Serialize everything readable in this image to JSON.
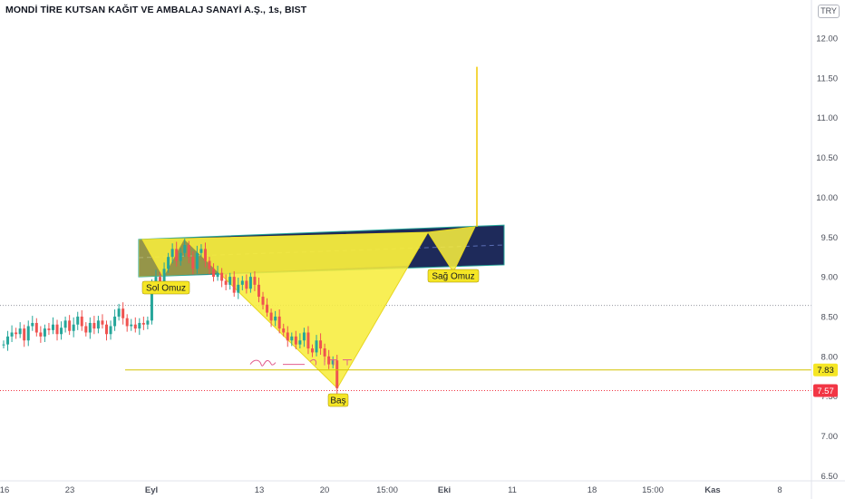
{
  "header": {
    "symbol_title": "MONDİ TİRE KUTSAN KAĞIT VE AMBALAJ SANAYİ A.Ş., 1s, BIST",
    "currency": "TRY"
  },
  "chart_data": {
    "type": "candlestick",
    "title": "MONDİ TİRE KUTSAN KAĞIT VE AMBALAJ SANAYİ A.Ş., 1s, BIST",
    "currency": "TRY",
    "y_ticks": [
      "12.00",
      "11.50",
      "11.00",
      "10.50",
      "10.00",
      "9.50",
      "9.00",
      "8.50",
      "8.00",
      "7.50",
      "7.00",
      "6.50"
    ],
    "y_tick_values": [
      12.0,
      11.5,
      11.0,
      10.5,
      10.0,
      9.5,
      9.0,
      8.5,
      8.0,
      7.5,
      7.0,
      6.5
    ],
    "ylim": [
      6.37,
      12.42
    ],
    "x_ticks": [
      "16",
      "23",
      "Eyl",
      "13",
      "20",
      "15:00",
      "Eki",
      "11",
      "18",
      "15:00",
      "Kas",
      "8"
    ],
    "x_tick_bold": [
      false,
      false,
      true,
      false,
      false,
      false,
      true,
      false,
      false,
      false,
      true,
      false
    ],
    "price_markers": [
      {
        "label": "7.83",
        "value": 7.83,
        "color": "#f5e625",
        "text_color": "#131722"
      },
      {
        "label": "7.57",
        "value": 7.57,
        "color": "#f23645",
        "text_color": "#ffffff"
      }
    ],
    "dotted_levels": [
      8.64,
      7.57
    ],
    "support_line": 7.83,
    "pattern_labels": [
      {
        "text": "Sol Omuz",
        "value": 9.0
      },
      {
        "text": "Sağ Omuz",
        "value": 9.06
      },
      {
        "text": "Baş",
        "value": 7.44
      }
    ],
    "channel": {
      "upper_start": 9.47,
      "upper_end": 9.65,
      "lower_start": 9.0,
      "lower_end": 9.15,
      "mid_start": 9.24,
      "mid_end": 9.4
    },
    "spike_line": [
      [
        9.63,
        11.64
      ]
    ],
    "series": [
      {
        "values": [
          8.15,
          8.25,
          8.3,
          8.28,
          8.35,
          8.2,
          8.38,
          8.42,
          8.3,
          8.25,
          8.35,
          8.33,
          8.4,
          8.28,
          8.36,
          8.45,
          8.32,
          8.4,
          8.5,
          8.38,
          8.3,
          8.42,
          8.35,
          8.45,
          8.4,
          8.28,
          8.38,
          8.5,
          8.6,
          8.48,
          8.38,
          8.4,
          8.35,
          8.42,
          8.4,
          8.45,
          8.9,
          9.0,
          8.88,
          9.1,
          9.25,
          9.35,
          9.2,
          9.3,
          9.4,
          9.25,
          9.1,
          9.3,
          9.35,
          9.2,
          9.1,
          9.0,
          9.05,
          8.95,
          8.9,
          9.0,
          8.8,
          8.9,
          8.95,
          8.85,
          9.0,
          8.9,
          8.75,
          8.65,
          8.55,
          8.45,
          8.5,
          8.35,
          8.3,
          8.2,
          8.25,
          8.15,
          8.2,
          8.3,
          8.1,
          8.05,
          8.2,
          8.1,
          8.0,
          7.9,
          7.95,
          7.6
        ]
      }
    ]
  }
}
